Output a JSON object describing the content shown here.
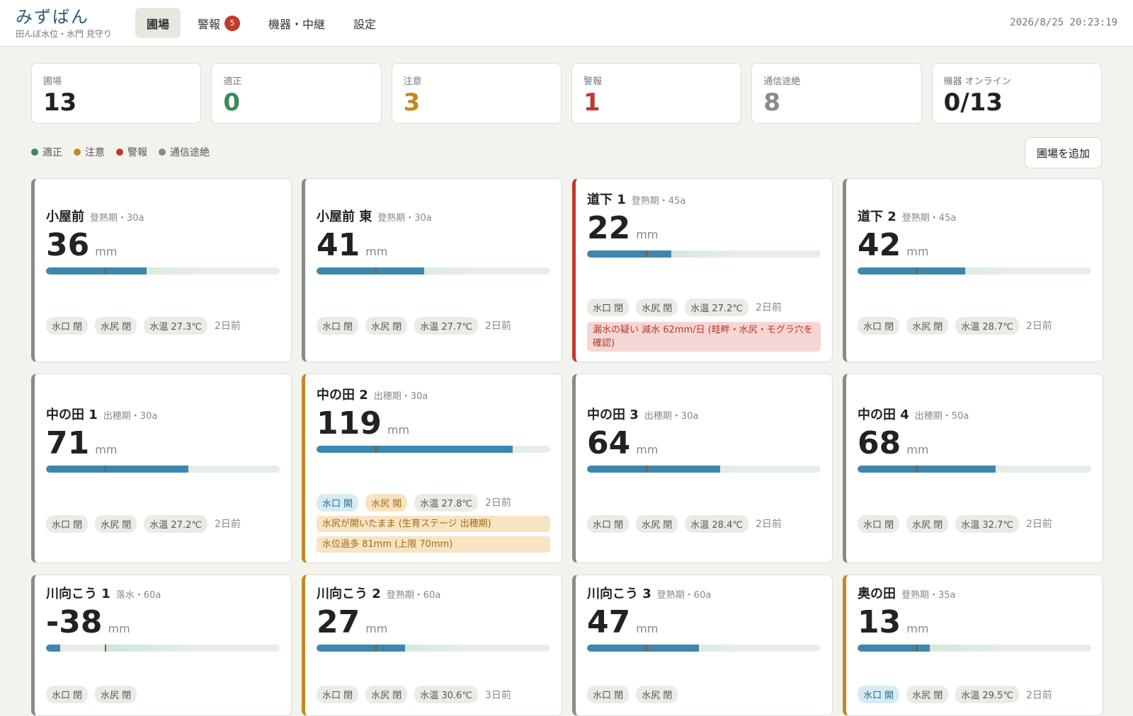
{
  "app": {
    "title": "みずばん",
    "subtitle": "田んぼ水位・水門 見守り"
  },
  "nav": {
    "tabs": [
      {
        "label": "圃場",
        "active": true
      },
      {
        "label": "警報",
        "badge": "5"
      },
      {
        "label": "機器・中継"
      },
      {
        "label": "設定"
      }
    ]
  },
  "clock": "2026/8/25 20:23:19",
  "summary": [
    {
      "label": "圃場",
      "value": "13",
      "color": "#222222"
    },
    {
      "label": "適正",
      "value": "0",
      "color": "#3a8a5c"
    },
    {
      "label": "注意",
      "value": "3",
      "color": "#c08a22"
    },
    {
      "label": "警報",
      "value": "1",
      "color": "#c0392b"
    },
    {
      "label": "通信途絶",
      "value": "8",
      "color": "#8a8a8a"
    },
    {
      "label": "機器 オンライン",
      "value": "0/13",
      "color": "#222222"
    }
  ],
  "legend": [
    {
      "label": "適正",
      "color": "#3a8a5c"
    },
    {
      "label": "注意",
      "color": "#c08a22"
    },
    {
      "label": "警報",
      "color": "#c0392b"
    },
    {
      "label": "通信途絶",
      "color": "#8a8a8a"
    }
  ],
  "add_button": "圃場を追加",
  "status_colors": {
    "ok": "#3a8a5c",
    "caution": "#c08a22",
    "alarm": "#c0392b",
    "offline": "#8a8a8a"
  },
  "unit": "mm",
  "fields": [
    {
      "name": "小屋前",
      "meta": "登熟期・30a",
      "level": "36",
      "fill_pct": 43,
      "status": "offline",
      "gates": [
        {
          "label": "水口 閉",
          "state": "closed"
        },
        {
          "label": "水尻 閉",
          "state": "closed"
        }
      ],
      "temp": "水温 27.3℃",
      "ago": "2日前",
      "alerts": []
    },
    {
      "name": "小屋前 東",
      "meta": "登熟期・30a",
      "level": "41",
      "fill_pct": 46,
      "status": "offline",
      "gates": [
        {
          "label": "水口 閉",
          "state": "closed"
        },
        {
          "label": "水尻 閉",
          "state": "closed"
        }
      ],
      "temp": "水温 27.7℃",
      "ago": "2日前",
      "alerts": []
    },
    {
      "name": "道下 1",
      "meta": "登熟期・45a",
      "level": "22",
      "fill_pct": 36,
      "status": "alarm",
      "gates": [
        {
          "label": "水口 閉",
          "state": "closed"
        },
        {
          "label": "水尻 閉",
          "state": "closed"
        }
      ],
      "temp": "水温 27.2℃",
      "ago": "2日前",
      "alerts": [
        {
          "text": "漏水の疑い 減水 62mm/日 (畦畔・水尻・モグラ穴を確認)",
          "kind": "red"
        }
      ]
    },
    {
      "name": "道下 2",
      "meta": "登熟期・45a",
      "level": "42",
      "fill_pct": 46,
      "status": "offline",
      "gates": [
        {
          "label": "水口 閉",
          "state": "closed"
        },
        {
          "label": "水尻 閉",
          "state": "closed"
        }
      ],
      "temp": "水温 28.7℃",
      "ago": "2日前",
      "alerts": []
    },
    {
      "name": "中の田 1",
      "meta": "出穂期・30a",
      "level": "71",
      "fill_pct": 61,
      "status": "offline",
      "gates": [
        {
          "label": "水口 閉",
          "state": "closed"
        },
        {
          "label": "水尻 閉",
          "state": "closed"
        }
      ],
      "temp": "水温 27.2℃",
      "ago": "2日前",
      "alerts": []
    },
    {
      "name": "中の田 2",
      "meta": "出穂期・30a",
      "level": "119",
      "fill_pct": 84,
      "status": "caution",
      "gates": [
        {
          "label": "水口 開",
          "state": "open-blue"
        },
        {
          "label": "水尻 開",
          "state": "open-orange"
        }
      ],
      "temp": "水温 27.8℃",
      "ago": "2日前",
      "alerts": [
        {
          "text": "水尻が開いたまま (生育ステージ 出穂期)",
          "kind": "orange"
        },
        {
          "text": "水位過多 81mm (上限 70mm)",
          "kind": "orange"
        }
      ]
    },
    {
      "name": "中の田 3",
      "meta": "出穂期・30a",
      "level": "64",
      "fill_pct": 57,
      "status": "offline",
      "gates": [
        {
          "label": "水口 閉",
          "state": "closed"
        },
        {
          "label": "水尻 閉",
          "state": "closed"
        }
      ],
      "temp": "水温 28.4℃",
      "ago": "2日前",
      "alerts": []
    },
    {
      "name": "中の田 4",
      "meta": "出穂期・50a",
      "level": "68",
      "fill_pct": 59,
      "status": "offline",
      "gates": [
        {
          "label": "水口 閉",
          "state": "closed"
        },
        {
          "label": "水尻 閉",
          "state": "closed"
        }
      ],
      "temp": "水温 32.7℃",
      "ago": "2日前",
      "alerts": []
    },
    {
      "name": "川向こう 1",
      "meta": "落水・60a",
      "level": "-38",
      "fill_pct": 6,
      "status": "offline",
      "gates": [
        {
          "label": "水口 閉",
          "state": "closed"
        },
        {
          "label": "水尻 閉",
          "state": "closed"
        }
      ],
      "temp": "",
      "ago": "",
      "alerts": []
    },
    {
      "name": "川向こう 2",
      "meta": "登熟期・60a",
      "level": "27",
      "fill_pct": 38,
      "status": "caution",
      "gates": [
        {
          "label": "水口 閉",
          "state": "closed"
        },
        {
          "label": "水尻 閉",
          "state": "closed"
        }
      ],
      "temp": "水温 30.6℃",
      "ago": "3日前",
      "alerts": []
    },
    {
      "name": "川向こう 3",
      "meta": "登熟期・60a",
      "level": "47",
      "fill_pct": 48,
      "status": "offline",
      "gates": [
        {
          "label": "水口 閉",
          "state": "closed"
        },
        {
          "label": "水尻 閉",
          "state": "closed"
        }
      ],
      "temp": "",
      "ago": "",
      "alerts": []
    },
    {
      "name": "奥の田",
      "meta": "登熟期・35a",
      "level": "13",
      "fill_pct": 31,
      "status": "caution",
      "gates": [
        {
          "label": "水口 開",
          "state": "open-blue"
        },
        {
          "label": "水尻 閉",
          "state": "closed"
        }
      ],
      "temp": "水温 29.5℃",
      "ago": "2日前",
      "alerts": []
    }
  ]
}
